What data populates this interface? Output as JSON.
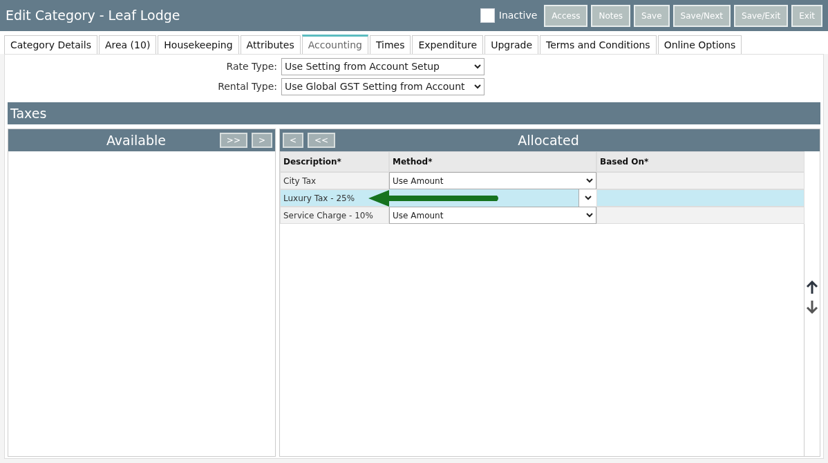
{
  "window": {
    "title": "Edit Category - Leaf Lodge"
  },
  "inactive": {
    "label": "Inactive",
    "checked": false
  },
  "buttons": [
    "Access",
    "Notes",
    "Save",
    "Save/Next",
    "Save/Exit",
    "Exit"
  ],
  "tabs": [
    {
      "label": "Category Details",
      "selected": false
    },
    {
      "label": "Area (10)",
      "selected": false
    },
    {
      "label": "Housekeeping",
      "selected": false
    },
    {
      "label": "Attributes",
      "selected": false
    },
    {
      "label": "Accounting",
      "selected": true
    },
    {
      "label": "Times",
      "selected": false
    },
    {
      "label": "Expenditure",
      "selected": false
    },
    {
      "label": "Upgrade",
      "selected": false
    },
    {
      "label": "Terms and Conditions",
      "selected": false
    },
    {
      "label": "Online Options",
      "selected": false
    }
  ],
  "fields": [
    {
      "label": "Rate Type:",
      "value": "Use Setting from Account Setup"
    },
    {
      "label": "Rental Type:",
      "value": "Use Global GST Setting from Account"
    }
  ],
  "section_title": "Taxes",
  "available": {
    "title": "Available",
    "buttons": [
      ">>",
      ">"
    ]
  },
  "allocated": {
    "title": "Allocated",
    "buttons": [
      "<",
      "<<"
    ],
    "columns": [
      "Description*",
      "Method*",
      "Based On*"
    ],
    "rows": [
      {
        "description": "City Tax",
        "method": "Use Amount",
        "selected": false
      },
      {
        "description": "Luxury Tax - 25%",
        "selected": true
      },
      {
        "description": "Service Charge - 10%",
        "method": "Use Amount",
        "selected": false
      }
    ]
  }
}
